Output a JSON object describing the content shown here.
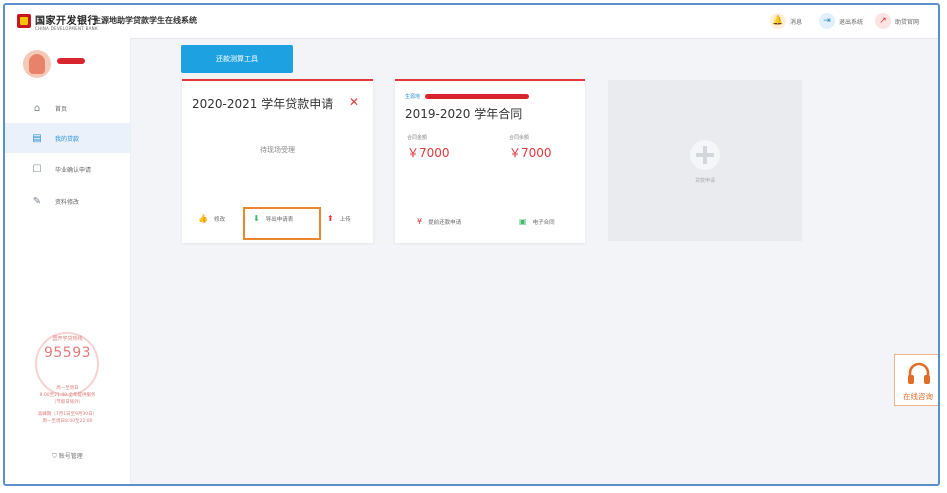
{
  "header": {
    "bank_name": "国家开发银行",
    "bank_name_en": "CHINA DEVELOPMENT BANK",
    "system_title": "生源地助学贷款学生在线系统",
    "actions": [
      {
        "icon": "bell-icon",
        "label": "消息",
        "color": "#f0a05a"
      },
      {
        "icon": "logout-icon",
        "label": "退出系统",
        "color": "#2a8dd4"
      },
      {
        "icon": "external-link-icon",
        "label": "助贷官网",
        "color": "#e4393c"
      }
    ]
  },
  "sidebar": {
    "items": [
      {
        "icon": "home-icon",
        "label": "首页",
        "active": false
      },
      {
        "icon": "document-icon",
        "label": "我的贷款",
        "active": true
      },
      {
        "icon": "graduation-icon",
        "label": "毕业确认申请",
        "active": false
      },
      {
        "icon": "edit-icon",
        "label": "资料修改",
        "active": false
      }
    ],
    "hotline": {
      "label": "国开学贷热线",
      "number": "95593",
      "lines": [
        "周一至周日",
        "8:00至21:00 全年提供服务",
        "（节假日除外）",
        "高峰期（7月1日至9月30日）",
        "周一至周日8:00至22:00"
      ]
    },
    "account_label": "账号管理"
  },
  "main": {
    "calc_button": "还款测算工具",
    "card_application": {
      "title": "2020-2021 学年贷款申请",
      "status": "待现场受理",
      "actions": [
        {
          "icon": "thumb-icon",
          "label": "修改"
        },
        {
          "icon": "download-icon",
          "label": "导出申请表"
        },
        {
          "icon": "upload-icon",
          "label": "上传"
        }
      ]
    },
    "card_contract": {
      "tag": "生源地",
      "title": "2019-2020 学年合同",
      "amount_label": "合同金额",
      "amount_value": "￥7000",
      "balance_label": "合同余额",
      "balance_value": "￥7000",
      "actions": [
        {
          "icon": "yen-icon",
          "label": "提前还款申请"
        },
        {
          "icon": "contract-icon",
          "label": "电子合同"
        }
      ]
    },
    "card_add": {
      "label": "贷款申请"
    },
    "consult_label": "在线咨询"
  }
}
